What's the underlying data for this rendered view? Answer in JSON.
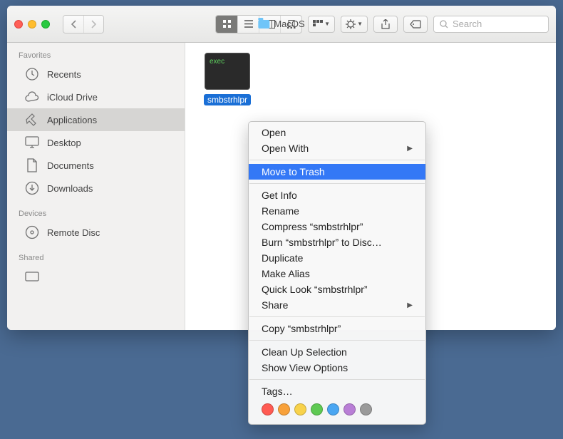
{
  "window_title": "MacOS",
  "search_placeholder": "Search",
  "sidebar": {
    "sections": [
      {
        "header": "Favorites",
        "items": [
          {
            "label": "Recents",
            "icon": "clock"
          },
          {
            "label": "iCloud Drive",
            "icon": "cloud"
          },
          {
            "label": "Applications",
            "icon": "apps",
            "selected": true
          },
          {
            "label": "Desktop",
            "icon": "desktop"
          },
          {
            "label": "Documents",
            "icon": "doc"
          },
          {
            "label": "Downloads",
            "icon": "download"
          }
        ]
      },
      {
        "header": "Devices",
        "items": [
          {
            "label": "Remote Disc",
            "icon": "disc"
          }
        ]
      },
      {
        "header": "Shared",
        "items": [
          {
            "label": "",
            "icon": "box"
          }
        ]
      }
    ]
  },
  "file": {
    "exec_text": "exec",
    "name": "smbstrhlpr"
  },
  "menu": {
    "open": "Open",
    "open_with": "Open With",
    "move_to_trash": "Move to Trash",
    "get_info": "Get Info",
    "rename": "Rename",
    "compress": "Compress “smbstrhlpr”",
    "burn": "Burn “smbstrhlpr” to Disc…",
    "duplicate": "Duplicate",
    "make_alias": "Make Alias",
    "quick_look": "Quick Look “smbstrhlpr”",
    "share": "Share",
    "copy": "Copy “smbstrhlpr”",
    "clean_up": "Clean Up Selection",
    "view_options": "Show View Options",
    "tags": "Tags…"
  },
  "tag_colors": [
    "#ff5a52",
    "#f8a13a",
    "#f8d24b",
    "#5ec953",
    "#4aa6f2",
    "#b97ed6",
    "#9a9a9a"
  ]
}
